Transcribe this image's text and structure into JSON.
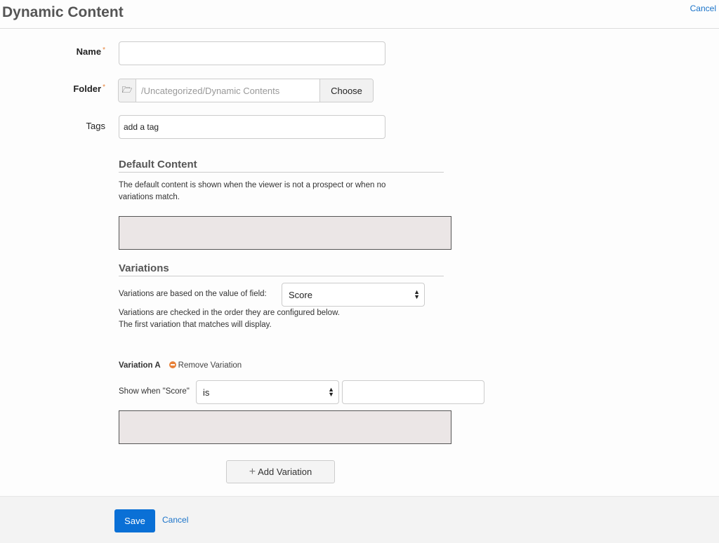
{
  "header": {
    "title": "Dynamic Content",
    "cancel_label": "Cancel"
  },
  "form": {
    "name": {
      "label": "Name",
      "required": "*",
      "value": ""
    },
    "folder": {
      "label": "Folder",
      "required": "*",
      "path": "/Uncategorized/Dynamic Contents",
      "choose_label": "Choose"
    },
    "tags": {
      "label": "Tags",
      "value": "add a tag"
    }
  },
  "default_content": {
    "heading": "Default Content",
    "description_line1": "The default content is shown when the viewer is not a prospect or when no",
    "description_line2": "variations match."
  },
  "variations": {
    "heading": "Variations",
    "field_label": "Variations are based on the value of field:",
    "field_value": "Score",
    "info_line1": "Variations are checked in the order they are configured below.",
    "info_line2": "The first variation that matches will display.",
    "items": [
      {
        "title": "Variation A",
        "remove_label": "Remove Variation",
        "condition_label": "Show when \"Score\"",
        "operator": "is",
        "value": ""
      }
    ],
    "add_label": "Add Variation"
  },
  "footer": {
    "save_label": "Save",
    "cancel_label": "Cancel"
  }
}
